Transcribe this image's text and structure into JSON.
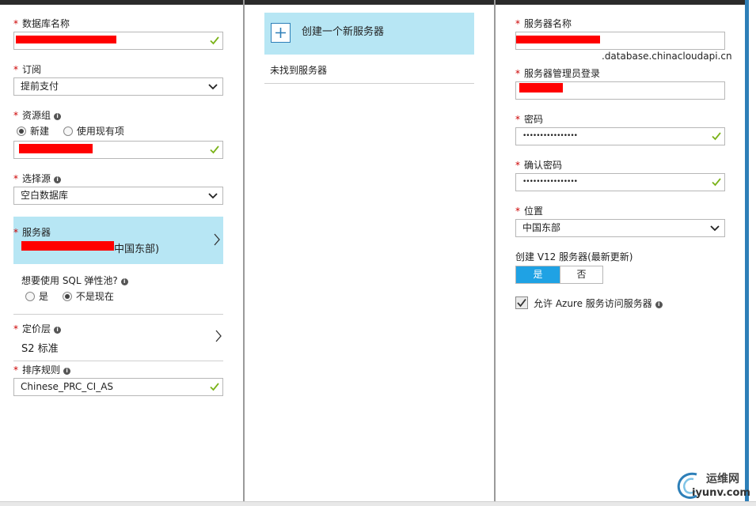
{
  "left": {
    "db_name_label": "数据库名称",
    "subscription_label": "订阅",
    "subscription_value": "提前支付",
    "resource_group_label": "资源组",
    "rg_new": "新建",
    "rg_existing": "使用现有项",
    "source_label": "选择源",
    "source_value": "空白数据库",
    "server_label": "服务器",
    "server_value_suffix": "中国东部)",
    "elastic_pool_question": "想要使用 SQL 弹性池?",
    "pool_yes": "是",
    "pool_no": "不是现在",
    "pricing_label": "定价层",
    "pricing_value": "S2 标准",
    "collation_label": "排序规则",
    "collation_value": "Chinese_PRC_CI_AS"
  },
  "middle": {
    "create_new_server": "创建一个新服务器",
    "no_servers_found": "未找到服务器"
  },
  "right": {
    "server_name_label": "服务器名称",
    "server_domain_suffix": ".database.chinacloudapi.cn",
    "admin_login_label": "服务器管理员登录",
    "password_label": "密码",
    "password_value": "••••••••••••••••",
    "confirm_password_label": "确认密码",
    "confirm_password_value": "••••••••••••••••",
    "location_label": "位置",
    "location_value": "中国东部",
    "v12_label": "创建 V12 服务器(最新更新)",
    "v12_yes": "是",
    "v12_no": "否",
    "allow_azure_label": "允许 Azure 服务访问服务器"
  },
  "watermark": {
    "line1": "运维网",
    "line2": "iyunv.com"
  },
  "colors": {
    "accent_blue": "#1fa2e4",
    "panel_highlight": "#b7e6f4",
    "required_star": "#cc0000",
    "valid_check": "#7bb31a",
    "redaction": "#ff0000"
  },
  "icons": [
    "info-icon",
    "check-icon",
    "chevron-down-icon",
    "chevron-right-icon",
    "plus-icon",
    "checkbox-checked-icon"
  ]
}
